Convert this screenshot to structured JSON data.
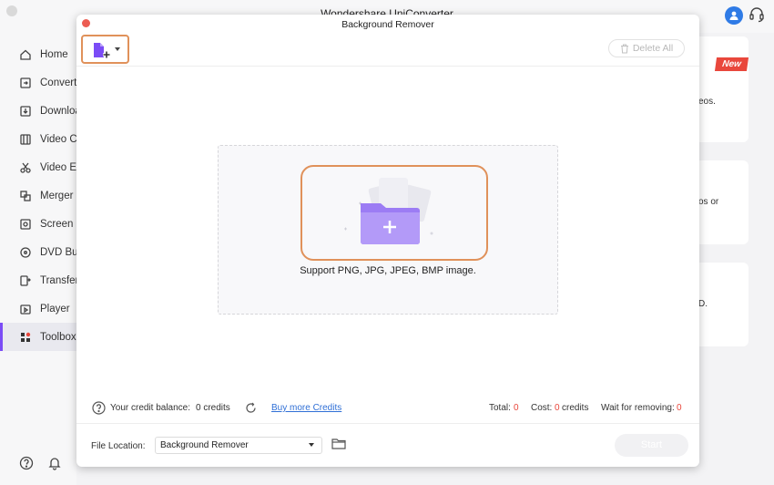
{
  "main_window": {
    "title": "Wondershare UniConverter",
    "sidebar": {
      "items": [
        {
          "label": "Home",
          "icon": "home-icon"
        },
        {
          "label": "Convert",
          "icon": "convert-icon"
        },
        {
          "label": "Download",
          "icon": "download-icon"
        },
        {
          "label": "Video Compressor",
          "icon": "video-compressor-icon"
        },
        {
          "label": "Video Editor",
          "icon": "video-editor-icon"
        },
        {
          "label": "Merger",
          "icon": "merger-icon"
        },
        {
          "label": "Screen Recorder",
          "icon": "screen-recorder-icon"
        },
        {
          "label": "DVD Burner",
          "icon": "dvd-burner-icon"
        },
        {
          "label": "Transfer",
          "icon": "transfer-icon"
        },
        {
          "label": "Player",
          "icon": "player-icon"
        },
        {
          "label": "Toolbox",
          "icon": "toolbox-icon",
          "active": true
        }
      ]
    },
    "right_cards": {
      "new_badge": "New",
      "snippets": [
        "eos.",
        "os or",
        "D."
      ]
    },
    "accent_color": "#7b4cf6"
  },
  "modal": {
    "title": "Background Remover",
    "delete_all_label": "Delete All",
    "support_text": "Support PNG, JPG, JPEG, BMP image.",
    "credits": {
      "balance_label": "Your credit balance:",
      "balance_value": "0 credits",
      "buy_more_label": "Buy more Credits",
      "total_label": "Total:",
      "total_value": "0",
      "cost_label": "Cost:",
      "cost_value": "0",
      "cost_unit": "credits",
      "wait_label": "Wait for removing:",
      "wait_value": "0"
    },
    "file_location": {
      "label": "File Location:",
      "value": "Background Remover"
    },
    "start_label": "Start",
    "highlight_color": "#e0915a"
  }
}
